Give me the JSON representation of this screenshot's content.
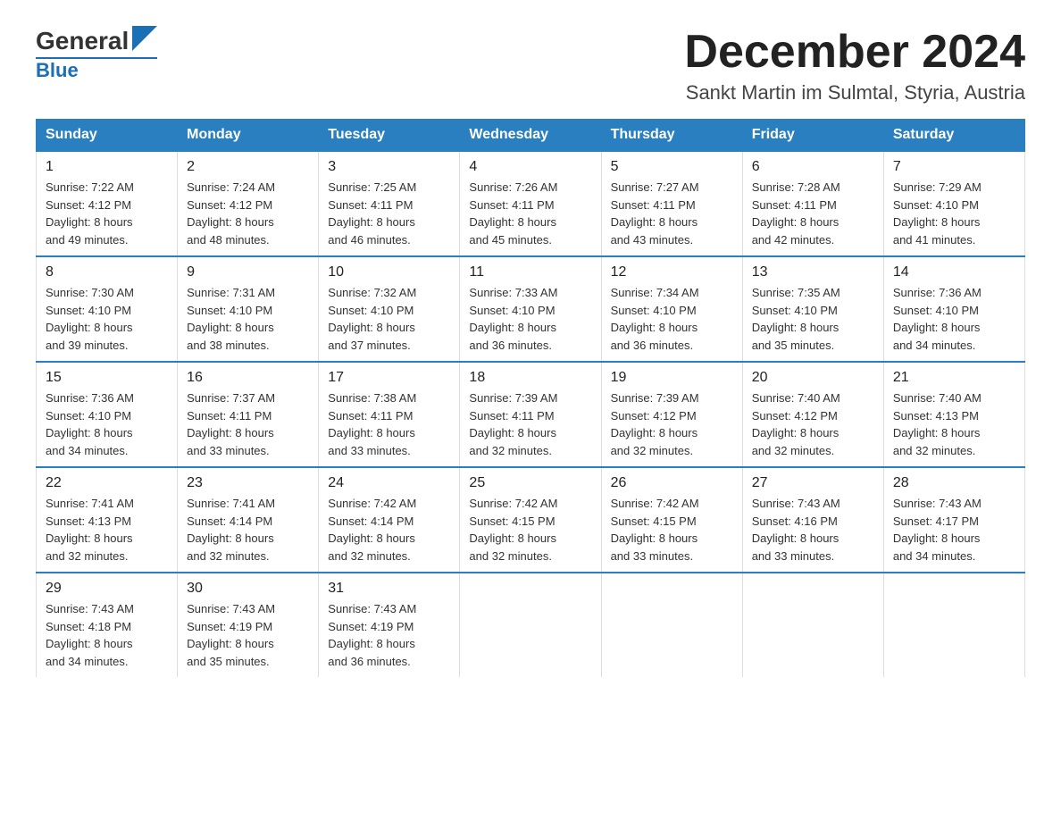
{
  "header": {
    "logo_general": "General",
    "logo_blue": "Blue",
    "month_year": "December 2024",
    "location": "Sankt Martin im Sulmtal, Styria, Austria"
  },
  "days_of_week": [
    "Sunday",
    "Monday",
    "Tuesday",
    "Wednesday",
    "Thursday",
    "Friday",
    "Saturday"
  ],
  "weeks": [
    [
      {
        "day": "1",
        "sunrise": "7:22 AM",
        "sunset": "4:12 PM",
        "daylight": "8 hours and 49 minutes."
      },
      {
        "day": "2",
        "sunrise": "7:24 AM",
        "sunset": "4:12 PM",
        "daylight": "8 hours and 48 minutes."
      },
      {
        "day": "3",
        "sunrise": "7:25 AM",
        "sunset": "4:11 PM",
        "daylight": "8 hours and 46 minutes."
      },
      {
        "day": "4",
        "sunrise": "7:26 AM",
        "sunset": "4:11 PM",
        "daylight": "8 hours and 45 minutes."
      },
      {
        "day": "5",
        "sunrise": "7:27 AM",
        "sunset": "4:11 PM",
        "daylight": "8 hours and 43 minutes."
      },
      {
        "day": "6",
        "sunrise": "7:28 AM",
        "sunset": "4:11 PM",
        "daylight": "8 hours and 42 minutes."
      },
      {
        "day": "7",
        "sunrise": "7:29 AM",
        "sunset": "4:10 PM",
        "daylight": "8 hours and 41 minutes."
      }
    ],
    [
      {
        "day": "8",
        "sunrise": "7:30 AM",
        "sunset": "4:10 PM",
        "daylight": "8 hours and 39 minutes."
      },
      {
        "day": "9",
        "sunrise": "7:31 AM",
        "sunset": "4:10 PM",
        "daylight": "8 hours and 38 minutes."
      },
      {
        "day": "10",
        "sunrise": "7:32 AM",
        "sunset": "4:10 PM",
        "daylight": "8 hours and 37 minutes."
      },
      {
        "day": "11",
        "sunrise": "7:33 AM",
        "sunset": "4:10 PM",
        "daylight": "8 hours and 36 minutes."
      },
      {
        "day": "12",
        "sunrise": "7:34 AM",
        "sunset": "4:10 PM",
        "daylight": "8 hours and 36 minutes."
      },
      {
        "day": "13",
        "sunrise": "7:35 AM",
        "sunset": "4:10 PM",
        "daylight": "8 hours and 35 minutes."
      },
      {
        "day": "14",
        "sunrise": "7:36 AM",
        "sunset": "4:10 PM",
        "daylight": "8 hours and 34 minutes."
      }
    ],
    [
      {
        "day": "15",
        "sunrise": "7:36 AM",
        "sunset": "4:10 PM",
        "daylight": "8 hours and 34 minutes."
      },
      {
        "day": "16",
        "sunrise": "7:37 AM",
        "sunset": "4:11 PM",
        "daylight": "8 hours and 33 minutes."
      },
      {
        "day": "17",
        "sunrise": "7:38 AM",
        "sunset": "4:11 PM",
        "daylight": "8 hours and 33 minutes."
      },
      {
        "day": "18",
        "sunrise": "7:39 AM",
        "sunset": "4:11 PM",
        "daylight": "8 hours and 32 minutes."
      },
      {
        "day": "19",
        "sunrise": "7:39 AM",
        "sunset": "4:12 PM",
        "daylight": "8 hours and 32 minutes."
      },
      {
        "day": "20",
        "sunrise": "7:40 AM",
        "sunset": "4:12 PM",
        "daylight": "8 hours and 32 minutes."
      },
      {
        "day": "21",
        "sunrise": "7:40 AM",
        "sunset": "4:13 PM",
        "daylight": "8 hours and 32 minutes."
      }
    ],
    [
      {
        "day": "22",
        "sunrise": "7:41 AM",
        "sunset": "4:13 PM",
        "daylight": "8 hours and 32 minutes."
      },
      {
        "day": "23",
        "sunrise": "7:41 AM",
        "sunset": "4:14 PM",
        "daylight": "8 hours and 32 minutes."
      },
      {
        "day": "24",
        "sunrise": "7:42 AM",
        "sunset": "4:14 PM",
        "daylight": "8 hours and 32 minutes."
      },
      {
        "day": "25",
        "sunrise": "7:42 AM",
        "sunset": "4:15 PM",
        "daylight": "8 hours and 32 minutes."
      },
      {
        "day": "26",
        "sunrise": "7:42 AM",
        "sunset": "4:15 PM",
        "daylight": "8 hours and 33 minutes."
      },
      {
        "day": "27",
        "sunrise": "7:43 AM",
        "sunset": "4:16 PM",
        "daylight": "8 hours and 33 minutes."
      },
      {
        "day": "28",
        "sunrise": "7:43 AM",
        "sunset": "4:17 PM",
        "daylight": "8 hours and 34 minutes."
      }
    ],
    [
      {
        "day": "29",
        "sunrise": "7:43 AM",
        "sunset": "4:18 PM",
        "daylight": "8 hours and 34 minutes."
      },
      {
        "day": "30",
        "sunrise": "7:43 AM",
        "sunset": "4:19 PM",
        "daylight": "8 hours and 35 minutes."
      },
      {
        "day": "31",
        "sunrise": "7:43 AM",
        "sunset": "4:19 PM",
        "daylight": "8 hours and 36 minutes."
      },
      null,
      null,
      null,
      null
    ]
  ],
  "labels": {
    "sunrise": "Sunrise:",
    "sunset": "Sunset:",
    "daylight": "Daylight:"
  }
}
